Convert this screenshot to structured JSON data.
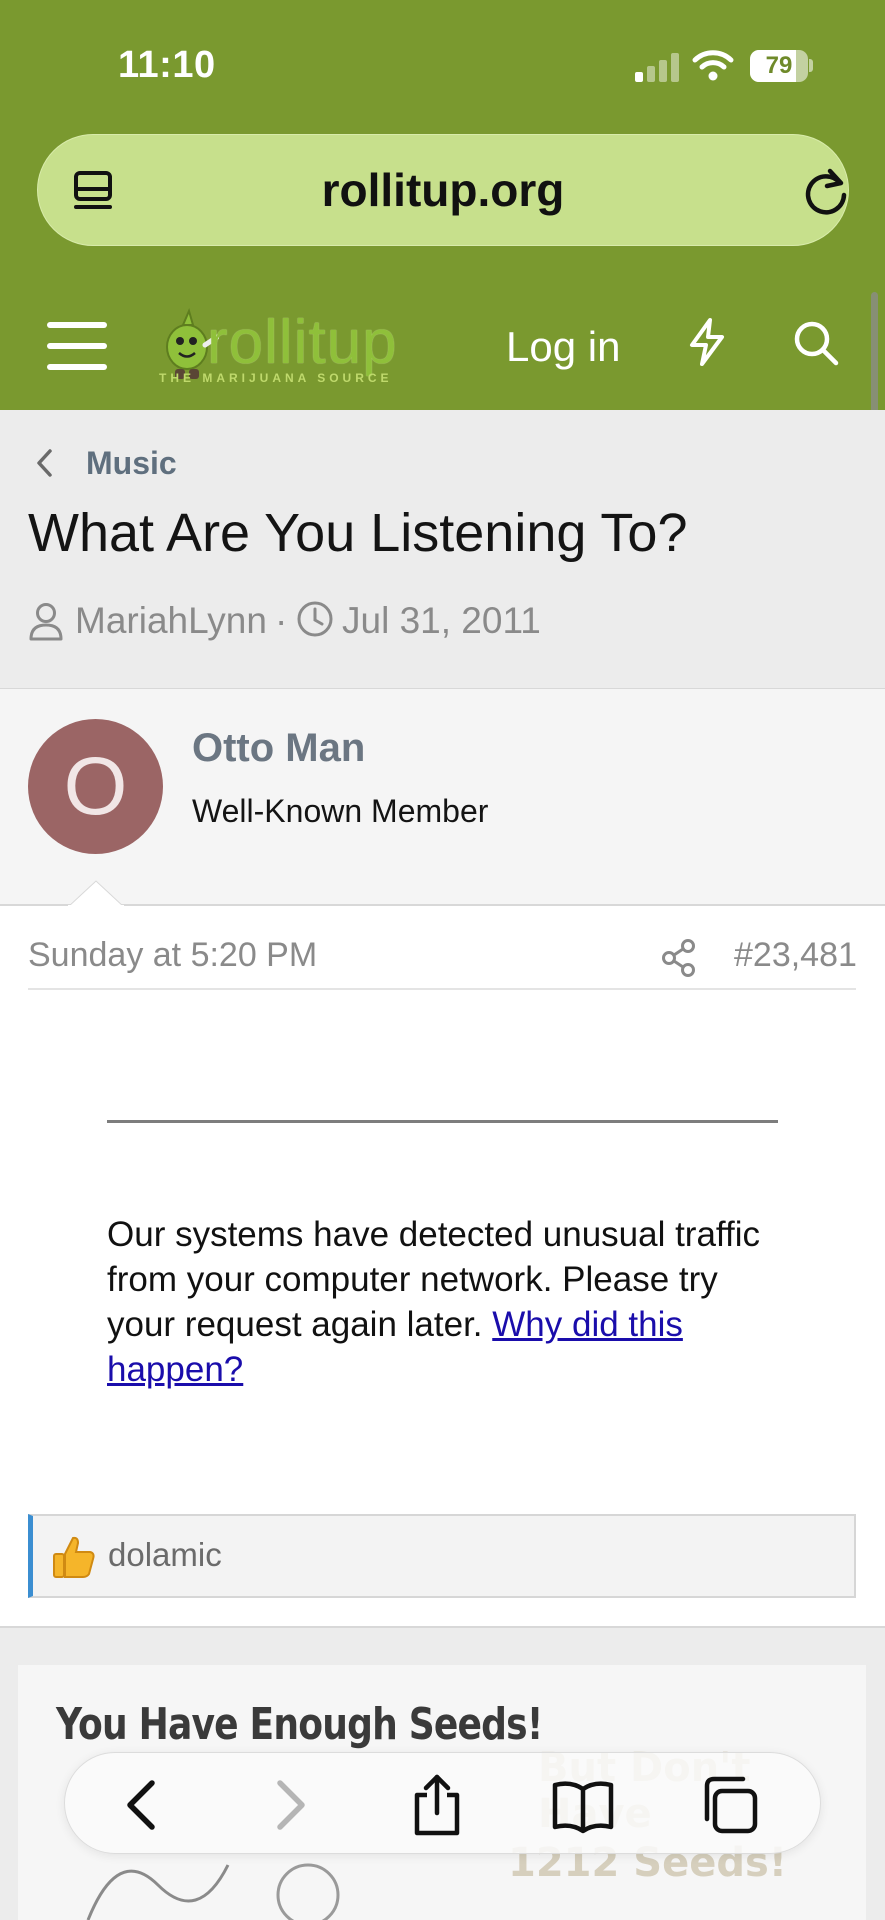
{
  "status_bar": {
    "time": "11:10",
    "battery": "79"
  },
  "browser": {
    "url": "rollitup.org"
  },
  "site_header": {
    "logo_text": "rollitup",
    "logo_tagline": "THE MARIJUANA SOURCE",
    "login_label": "Log in"
  },
  "breadcrumb": {
    "label": "Music"
  },
  "thread": {
    "title": "What Are You Listening To?",
    "author": "MariahLynn",
    "separator": "·",
    "date": "Jul 31, 2011"
  },
  "post": {
    "avatar_letter": "O",
    "username": "Otto Man",
    "user_title": "Well-Known Member",
    "date": "Sunday at 5:20 PM",
    "number": "#23,481",
    "embed_message": "Our systems have detected unusual traffic from your computer network. Please try your request again later.",
    "embed_link": "Why did this happen?",
    "reaction_user": "dolamic"
  },
  "ad": {
    "title": "You Have Enough Seeds!",
    "right_line1": "But Don't Have",
    "right_line2": "1212 Seeds!"
  },
  "colors": {
    "header_green": "#7a992f",
    "url_bar": "#c7e08c",
    "avatar": "#9b6565",
    "link": "#1a0dab",
    "reaction_accent": "#3b8ed1"
  },
  "icons": {
    "tabs": "tabs-icon",
    "reload": "reload-icon",
    "menu": "hamburger-icon",
    "whats_new": "bolt-icon",
    "search": "search-icon",
    "back": "chevron-left-icon",
    "user": "user-icon",
    "clock": "clock-icon",
    "share": "share-icon",
    "like": "thumbs-up-icon",
    "toolbar": [
      "back-icon",
      "forward-icon",
      "share-icon",
      "bookmarks-icon",
      "tabs-icon"
    ]
  }
}
